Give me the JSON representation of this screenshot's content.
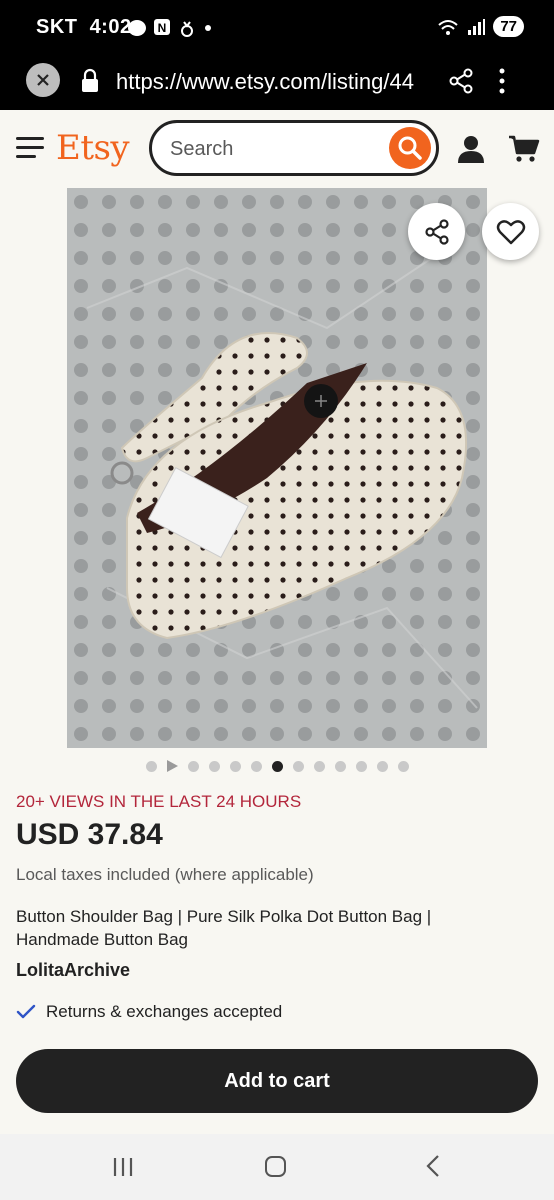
{
  "status_bar": {
    "carrier": "SKT",
    "time": "4:02",
    "battery": "77"
  },
  "browser": {
    "url": "https://www.etsy.com/listing/44"
  },
  "header": {
    "logo": "Etsy",
    "search_placeholder": "Search"
  },
  "gallery": {
    "image_count": 13,
    "active_index": 6,
    "video_index": 1
  },
  "listing": {
    "views_notice": "20+ VIEWS IN THE LAST 24 HOURS",
    "price": "USD 37.84",
    "tax_note": "Local taxes included (where applicable)",
    "title": "Button Shoulder Bag | Pure Silk Polka Dot Button Bag | Handmade Button Bag",
    "shop_name": "LolitaArchive",
    "returns": "Returns & exchanges accepted",
    "add_to_cart": "Add to cart"
  },
  "colors": {
    "brand": "#f1641e",
    "views": "#b3263b",
    "button": "#222222"
  }
}
